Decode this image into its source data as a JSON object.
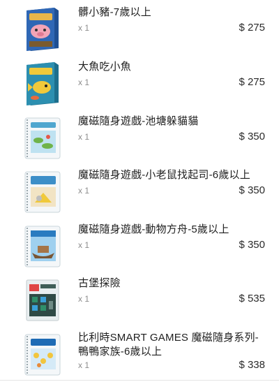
{
  "items": [
    {
      "name": "髒小豬-7歲以上",
      "qty": "x 1",
      "price": "$ 275",
      "colors": {
        "primary": "#2f67b5",
        "accent": "#e8b64a"
      }
    },
    {
      "name": "大魚吃小魚",
      "qty": "x 1",
      "price": "$ 275",
      "colors": {
        "primary": "#2c8fb0",
        "accent": "#f0c93a"
      }
    },
    {
      "name": "魔磁隨身遊戲-池塘躲貓貓",
      "qty": "x 1",
      "price": "$ 350",
      "colors": {
        "primary": "#4fa6cf",
        "accent": "#6fb34a"
      }
    },
    {
      "name": "魔磁隨身遊戲-小老鼠找起司-6歲以上",
      "qty": "x 1",
      "price": "$ 350",
      "colors": {
        "primary": "#3d8fc8",
        "accent": "#d8b067"
      }
    },
    {
      "name": "魔磁隨身遊戲-動物方舟-5歲以上",
      "qty": "x 1",
      "price": "$ 350",
      "colors": {
        "primary": "#2a7bc0",
        "accent": "#7a5533"
      }
    },
    {
      "name": "古堡探險",
      "qty": "x 1",
      "price": "$ 535",
      "colors": {
        "primary": "#3f5e58",
        "accent": "#2f8f6a"
      }
    },
    {
      "name": "比利時SMART GAMES 魔磁隨身系列-鴨鴨家族-6歲以上",
      "qty": "x 1",
      "price": "$ 338",
      "colors": {
        "primary": "#1e6bb5",
        "accent": "#f2c53d"
      }
    }
  ]
}
